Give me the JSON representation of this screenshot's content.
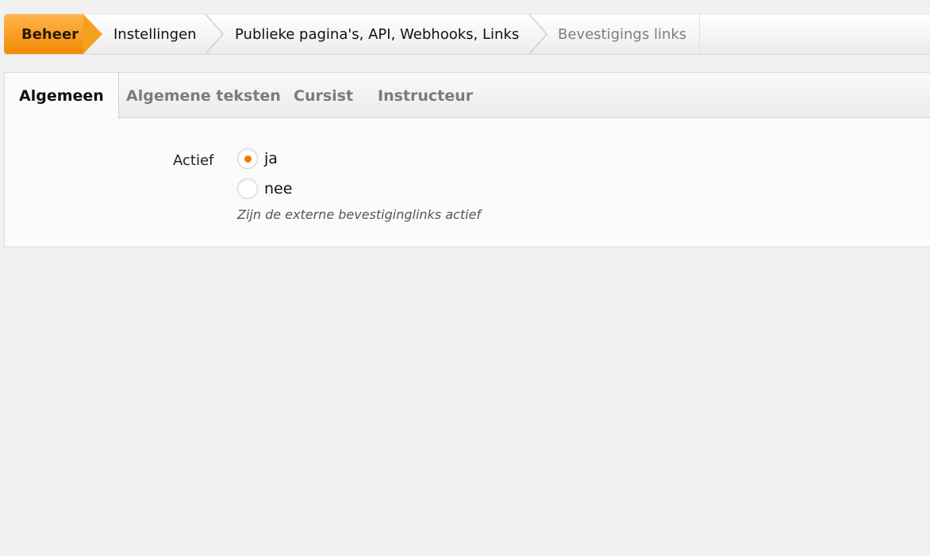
{
  "breadcrumb": {
    "home": "Beheer",
    "items": [
      "Instellingen",
      "Publieke pagina's, API, Webhooks, Links"
    ],
    "current": "Bevestigings links"
  },
  "tabs": [
    {
      "label": "Algemeen",
      "active": true
    },
    {
      "label": "Algemene teksten",
      "active": false
    },
    {
      "label": "Cursist",
      "active": false
    },
    {
      "label": "Instructeur",
      "active": false
    }
  ],
  "form": {
    "label": "Actief",
    "options": [
      {
        "label": "ja",
        "selected": true
      },
      {
        "label": "nee",
        "selected": false
      }
    ],
    "help": "Zijn de externe bevestiginglinks actief"
  },
  "colors": {
    "accent": "#f28a05",
    "radio_dot": "#f07d00",
    "muted_text": "#7e7e7e"
  },
  "icons": {
    "separator": "chevron-right-icon"
  }
}
